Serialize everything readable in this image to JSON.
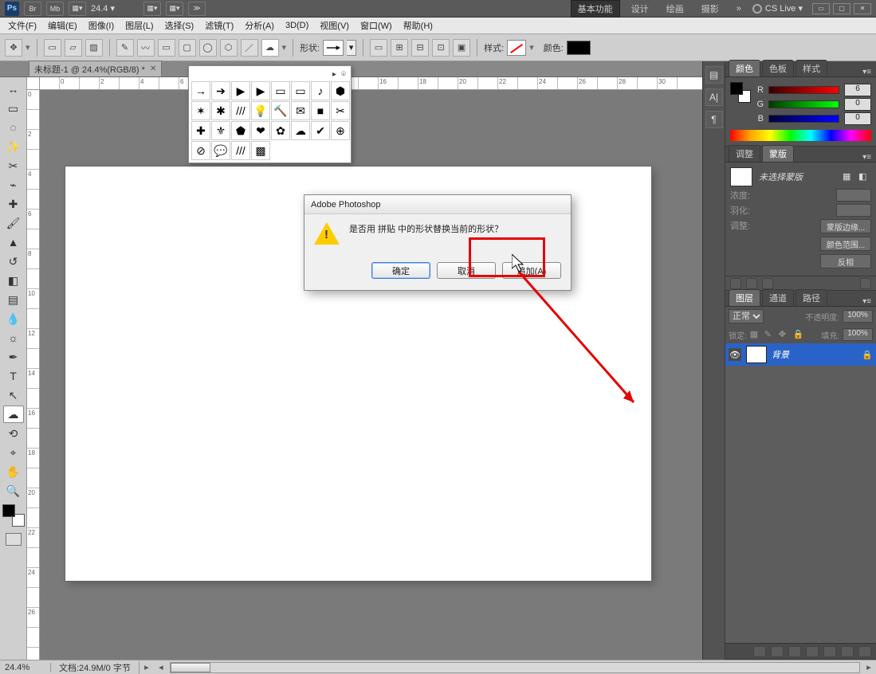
{
  "app_top": {
    "logo": "Ps",
    "mini_buttons": [
      "Br",
      "Mb",
      "▦▾"
    ],
    "zoom": "24.4 ▾",
    "extra": [
      "▦▾",
      "▦▾",
      "≫"
    ],
    "workspace_tabs": [
      "基本功能",
      "设计",
      "绘画",
      "摄影",
      "»"
    ],
    "cslive": "CS Live ▾",
    "win": [
      "▭",
      "▢",
      "✕"
    ]
  },
  "menu": {
    "items": [
      "文件(F)",
      "编辑(E)",
      "图像(I)",
      "图层(L)",
      "选择(S)",
      "滤镜(T)",
      "分析(A)",
      "3D(D)",
      "视图(V)",
      "窗口(W)",
      "帮助(H)"
    ]
  },
  "options": {
    "shape_label": "形状:",
    "style_label": "样式:",
    "color_label": "颜色:"
  },
  "doc_tab": {
    "title": "未标题-1 @ 24.4%(RGB/8) *"
  },
  "dialog": {
    "title": "Adobe Photoshop",
    "message": "是否用 拼贴 中的形状替换当前的形状？",
    "ok": "确定",
    "cancel": "取消",
    "append": "追加(A)"
  },
  "panels": {
    "color": {
      "tabs": [
        "颜色",
        "色板",
        "样式"
      ],
      "r": "6",
      "g": "0",
      "b": "0"
    },
    "mask": {
      "tabs": [
        "调整",
        "蒙版"
      ],
      "no_mask": "未选择蒙版",
      "density": "浓度:",
      "feather": "羽化:",
      "adjust": "调整:",
      "btns": [
        "蒙版边缘...",
        "颜色范围...",
        "反相"
      ]
    },
    "layers": {
      "tabs": [
        "图层",
        "通道",
        "路径"
      ],
      "mode": "正常",
      "opacity_lbl": "不透明度:",
      "opacity": "100%",
      "lock_lbl": "锁定:",
      "fill_lbl": "填充:",
      "fill": "100%",
      "bg_layer": "背景"
    }
  },
  "status": {
    "zoom": "24.4%",
    "doc": "文档:24.9M/0 字节"
  },
  "shape_cells": [
    "→",
    "➔",
    "▶",
    "▶",
    "▭",
    "▭",
    "♪",
    "⬢",
    "✶",
    "✱",
    "///",
    "💡",
    "🔨",
    "✉",
    "■",
    "✂",
    "✚",
    "⚜",
    "⬟",
    "❤",
    "✿",
    "☁",
    "✔",
    "⊕",
    "⊘",
    "💬",
    "///",
    "▩"
  ]
}
